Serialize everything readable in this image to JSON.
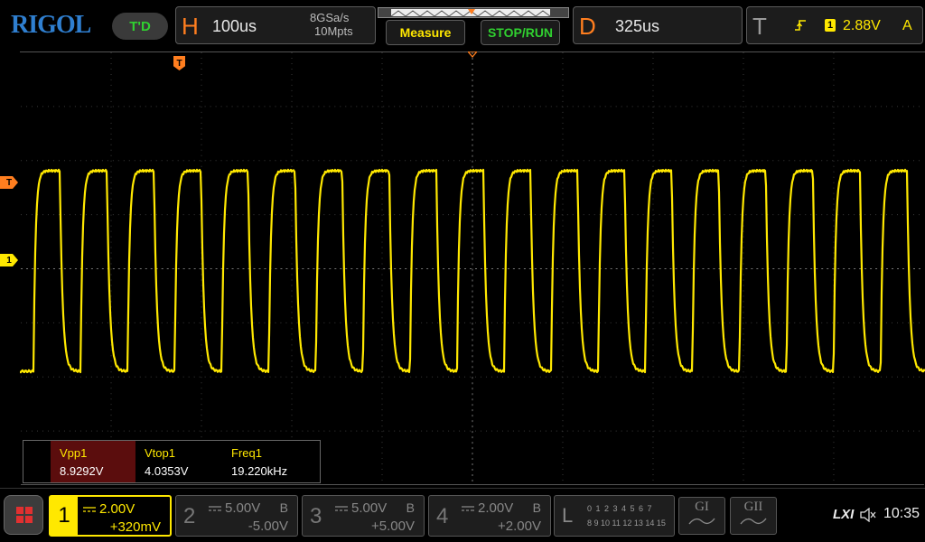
{
  "header": {
    "logo": "RIGOL",
    "trigger_status": "T'D",
    "horizontal": {
      "letter": "H",
      "timebase": "100us",
      "sample_rate": "8GSa/s",
      "memory_depth": "10Mpts"
    },
    "measure_label": "Measure",
    "stop_run_label": "STOP/RUN",
    "delay": {
      "letter": "D",
      "value": "325us"
    },
    "trigger": {
      "letter": "T",
      "source": "1",
      "level": "2.88V",
      "mode": "A"
    }
  },
  "markers": {
    "trigger_level": "T",
    "channel1": "1",
    "trigger_position": "T"
  },
  "waveform": {
    "channel": "1",
    "color": "#ffe800",
    "period_us": 52,
    "high_level_div": 1.8,
    "low_level_div": -1.9,
    "first_rise_us": 15,
    "duty_fraction": 0.56,
    "time_span_us": 1000,
    "volts_per_div": 2.0
  },
  "measurements": [
    {
      "label": "Vpp1",
      "value": "8.9292V"
    },
    {
      "label": "Vtop1",
      "value": "4.0353V"
    },
    {
      "label": "Freq1",
      "value": "19.220kHz"
    }
  ],
  "channels": [
    {
      "num": "1",
      "scale": "2.00V",
      "offset": "+320mV",
      "bw": "",
      "active": true
    },
    {
      "num": "2",
      "scale": "5.00V",
      "offset": "-5.00V",
      "bw": "B",
      "active": false
    },
    {
      "num": "3",
      "scale": "5.00V",
      "offset": "+5.00V",
      "bw": "B",
      "active": false
    },
    {
      "num": "4",
      "scale": "2.00V",
      "offset": "+2.00V",
      "bw": "B",
      "active": false
    }
  ],
  "logic": {
    "label": "L",
    "row1": "0 1 2 3  4 5 6 7",
    "row2": "8 9 10 11 12 13 14 15"
  },
  "decode": [
    {
      "label": "GI"
    },
    {
      "label": "GII"
    }
  ],
  "status": {
    "lxi": "LXI",
    "time": "10:35"
  },
  "colors": {
    "accent_orange": "#ff7e1f",
    "channel1_yellow": "#ffe800",
    "run_green": "#30d030",
    "logo_blue": "#2f7fd0"
  }
}
